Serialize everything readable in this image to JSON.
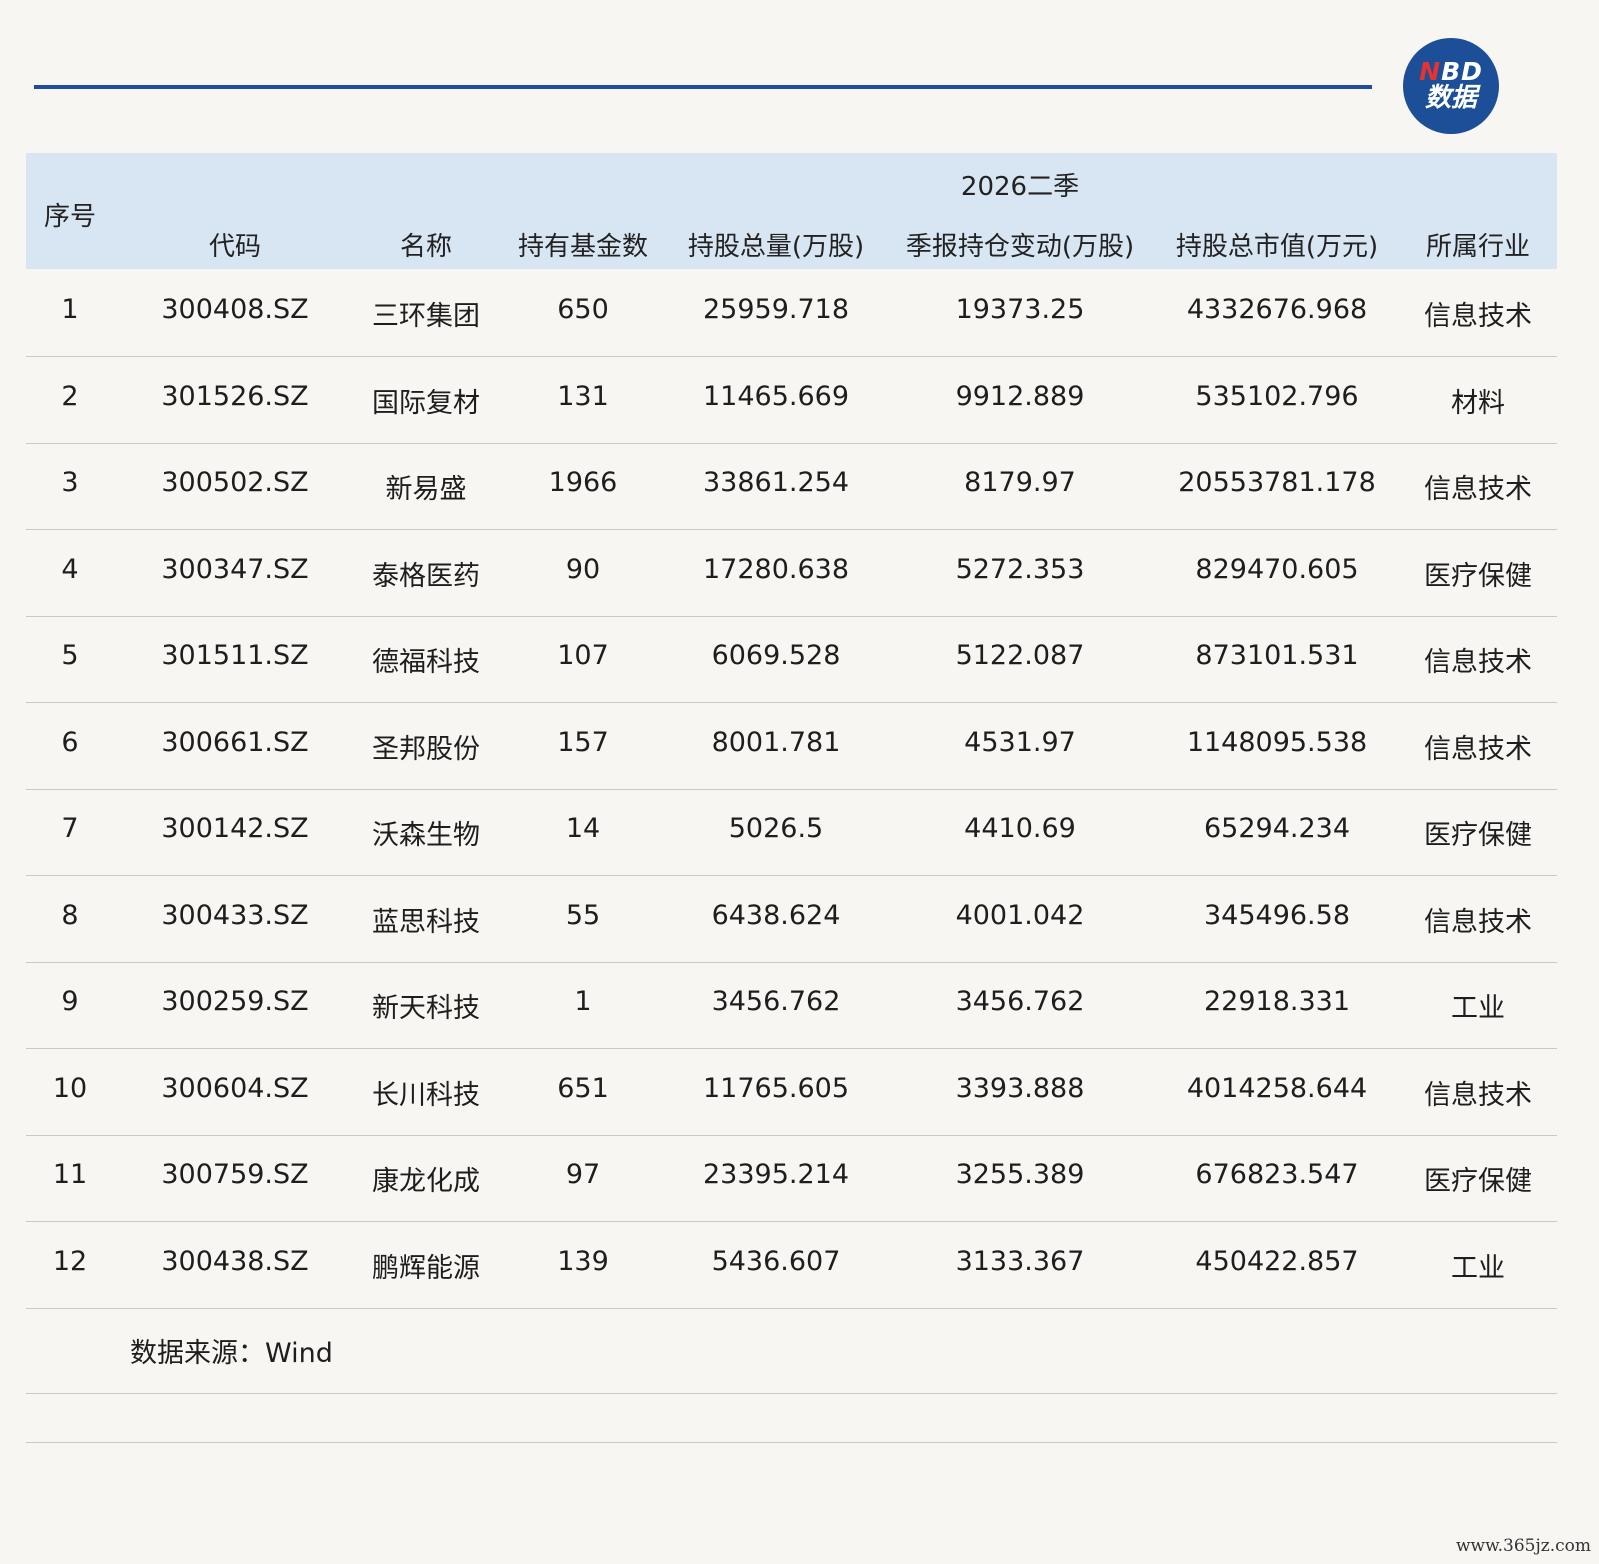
{
  "logo": {
    "brand_n": "N",
    "brand_rest": "BD",
    "sub": "数据"
  },
  "header": {
    "seq": "序号",
    "group": "2026二季",
    "columns": [
      "代码",
      "名称",
      "持有基金数",
      "持股总量(万股)",
      "季报持仓变动(万股)",
      "持股总市值(万元)",
      "所属行业"
    ]
  },
  "rows": [
    {
      "seq": "1",
      "code": "300408.SZ",
      "name": "三环集团",
      "funds": "650",
      "total": "25959.718",
      "change": "19373.25",
      "value": "4332676.968",
      "industry": "信息技术"
    },
    {
      "seq": "2",
      "code": "301526.SZ",
      "name": "国际复材",
      "funds": "131",
      "total": "11465.669",
      "change": "9912.889",
      "value": "535102.796",
      "industry": "材料"
    },
    {
      "seq": "3",
      "code": "300502.SZ",
      "name": "新易盛",
      "funds": "1966",
      "total": "33861.254",
      "change": "8179.97",
      "value": "20553781.178",
      "industry": "信息技术"
    },
    {
      "seq": "4",
      "code": "300347.SZ",
      "name": "泰格医药",
      "funds": "90",
      "total": "17280.638",
      "change": "5272.353",
      "value": "829470.605",
      "industry": "医疗保健"
    },
    {
      "seq": "5",
      "code": "301511.SZ",
      "name": "德福科技",
      "funds": "107",
      "total": "6069.528",
      "change": "5122.087",
      "value": "873101.531",
      "industry": "信息技术"
    },
    {
      "seq": "6",
      "code": "300661.SZ",
      "name": "圣邦股份",
      "funds": "157",
      "total": "8001.781",
      "change": "4531.97",
      "value": "1148095.538",
      "industry": "信息技术"
    },
    {
      "seq": "7",
      "code": "300142.SZ",
      "name": "沃森生物",
      "funds": "14",
      "total": "5026.5",
      "change": "4410.69",
      "value": "65294.234",
      "industry": "医疗保健"
    },
    {
      "seq": "8",
      "code": "300433.SZ",
      "name": "蓝思科技",
      "funds": "55",
      "total": "6438.624",
      "change": "4001.042",
      "value": "345496.58",
      "industry": "信息技术"
    },
    {
      "seq": "9",
      "code": "300259.SZ",
      "name": "新天科技",
      "funds": "1",
      "total": "3456.762",
      "change": "3456.762",
      "value": "22918.331",
      "industry": "工业"
    },
    {
      "seq": "10",
      "code": "300604.SZ",
      "name": "长川科技",
      "funds": "651",
      "total": "11765.605",
      "change": "3393.888",
      "value": "4014258.644",
      "industry": "信息技术"
    },
    {
      "seq": "11",
      "code": "300759.SZ",
      "name": "康龙化成",
      "funds": "97",
      "total": "23395.214",
      "change": "3255.389",
      "value": "676823.547",
      "industry": "医疗保健"
    },
    {
      "seq": "12",
      "code": "300438.SZ",
      "name": "鹏辉能源",
      "funds": "139",
      "total": "5436.607",
      "change": "3133.367",
      "value": "450422.857",
      "industry": "工业"
    }
  ],
  "source": "数据来源：Wind",
  "site": "www.365jz.com",
  "colors": {
    "brand_blue": "#1c4f97",
    "header_band": "#d8e6f3",
    "background": "#f8f6f2"
  }
}
